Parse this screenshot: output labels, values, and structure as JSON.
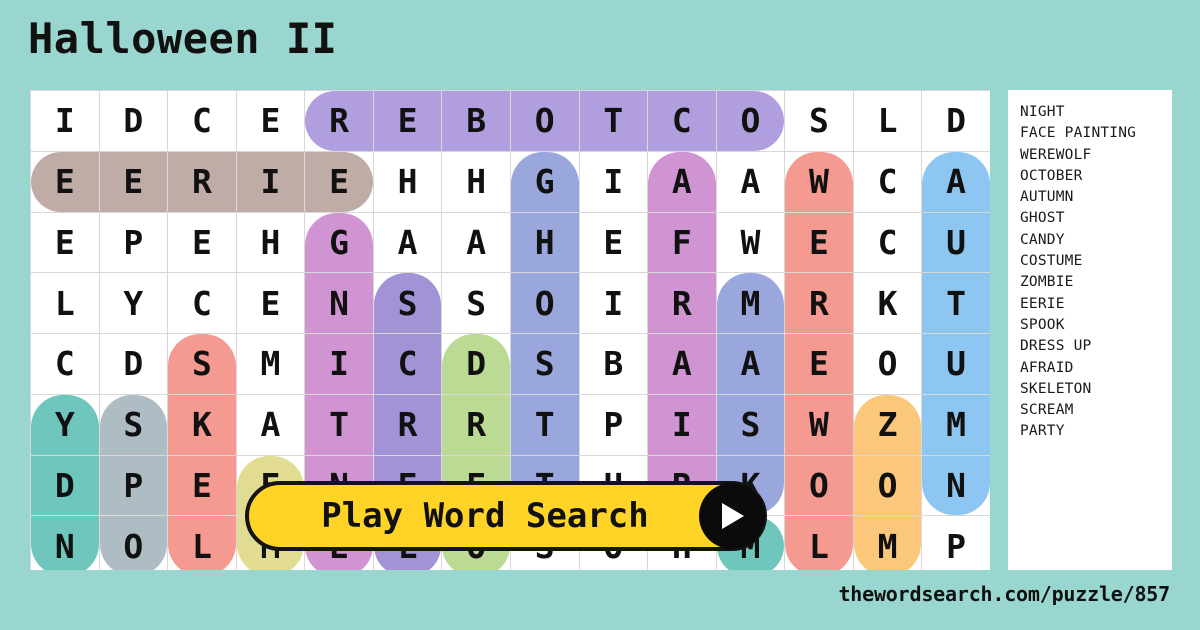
{
  "title": "Halloween II",
  "theme": {
    "background": "#99d6d0",
    "panel": "#ffffff",
    "text": "#111111",
    "button_fill": "#FFD426",
    "button_border": "#141414"
  },
  "grid": {
    "rows": 8,
    "cols": 14,
    "letters": [
      [
        "I",
        "D",
        "C",
        "E",
        "R",
        "E",
        "B",
        "O",
        "T",
        "C",
        "O",
        "S",
        "L",
        "D"
      ],
      [
        "E",
        "E",
        "R",
        "I",
        "E",
        "H",
        "H",
        "G",
        "I",
        "A",
        "A",
        "W",
        "C",
        "A"
      ],
      [
        "E",
        "P",
        "E",
        "H",
        "G",
        "A",
        "A",
        "H",
        "E",
        "F",
        "W",
        "E",
        "C",
        "U"
      ],
      [
        "L",
        "Y",
        "C",
        "E",
        "N",
        "S",
        "S",
        "O",
        "I",
        "R",
        "M",
        "R",
        "K",
        "T"
      ],
      [
        "C",
        "D",
        "S",
        "M",
        "I",
        "C",
        "D",
        "S",
        "B",
        "A",
        "A",
        "E",
        "O",
        "U"
      ],
      [
        "Y",
        "S",
        "K",
        "A",
        "T",
        "R",
        "R",
        "T",
        "P",
        "I",
        "S",
        "W",
        "Z",
        "M"
      ],
      [
        "D",
        "P",
        "E",
        "E",
        "N",
        "E",
        "E",
        "T",
        "H",
        "R",
        "K",
        "O",
        "O",
        "N"
      ],
      [
        "N",
        "O",
        "L",
        "M",
        "E",
        "L",
        "O",
        "S",
        "O",
        "H",
        "M",
        "L",
        "M",
        "P"
      ]
    ],
    "highlights": [
      {
        "word": "OCTOBER",
        "color": "#b09ede",
        "orientation": "horizontal",
        "row": 0,
        "col_start": 4,
        "col_end": 10
      },
      {
        "word": "EERIE",
        "color": "#bfaca6",
        "orientation": "horizontal",
        "row": 1,
        "col_start": 0,
        "col_end": 4
      },
      {
        "word": "GHOST",
        "color": "#9aa7dd",
        "orientation": "vertical",
        "col": 7,
        "row_start": 1,
        "row_end": 5
      },
      {
        "word": "AFRAID",
        "color": "#d194d3",
        "orientation": "vertical",
        "col": 9,
        "row_start": 1,
        "row_end": 6
      },
      {
        "word": "WEREWOLF",
        "color": "#f59a90",
        "orientation": "vertical",
        "col": 11,
        "row_start": 1,
        "row_end": 7
      },
      {
        "word": "AUTUMN",
        "color": "#8ec6f2",
        "orientation": "vertical",
        "col": 13,
        "row_start": 1,
        "row_end": 6
      },
      {
        "word": "GNIT",
        "color": "#d194d3",
        "orientation": "vertical",
        "col": 4,
        "row_start": 2,
        "row_end": 6
      },
      {
        "word": "SCREAM",
        "color": "#a193d6",
        "orientation": "vertical",
        "col": 5,
        "row_start": 3,
        "row_end": 7
      },
      {
        "word": "MAERCS",
        "color": "#9aa7dd",
        "orientation": "vertical",
        "col": 10,
        "row_start": 3,
        "row_end": 6
      },
      {
        "word": "SPOOK",
        "color": "#f59a90",
        "orientation": "vertical",
        "col": 2,
        "row_start": 4,
        "row_end": 7
      },
      {
        "word": "DRESSUP",
        "color": "#bbdb95",
        "orientation": "vertical",
        "col": 6,
        "row_start": 4,
        "row_end": 7
      },
      {
        "word": "CANDY",
        "color": "#6ec6bd",
        "orientation": "vertical",
        "col": 0,
        "row_start": 5,
        "row_end": 7
      },
      {
        "word": "SPOOK2",
        "color": "#aebdc4",
        "orientation": "vertical",
        "col": 1,
        "row_start": 5,
        "row_end": 7
      },
      {
        "word": "PARTY",
        "color": "#9aa7dd",
        "orientation": "vertical",
        "col": 7,
        "row_start": 5,
        "row_end": 6
      },
      {
        "word": "ZOMBIE",
        "color": "#fbc87b",
        "orientation": "vertical",
        "col": 12,
        "row_start": 5,
        "row_end": 7
      },
      {
        "word": "FACE",
        "color": "#e2dc93",
        "orientation": "vertical",
        "col": 3,
        "row_start": 6,
        "row_end": 7
      },
      {
        "word": "PAINT",
        "color": "#d194d3",
        "orientation": "vertical",
        "col": 4,
        "row_start": 7,
        "row_end": 7
      },
      {
        "word": "PAINT2",
        "color": "#a193d6",
        "orientation": "vertical",
        "col": 5,
        "row_start": 7,
        "row_end": 7
      },
      {
        "word": "ING",
        "color": "#bbdb95",
        "orientation": "vertical",
        "col": 6,
        "row_start": 7,
        "row_end": 7
      },
      {
        "word": "HALLO",
        "color": "#6ec6bd",
        "orientation": "vertical",
        "col": 10,
        "row_start": 7,
        "row_end": 7
      }
    ]
  },
  "wordlist": {
    "words": [
      "NIGHT",
      "FACE PAINTING",
      "WEREWOLF",
      "OCTOBER",
      "AUTUMN",
      "GHOST",
      "CANDY",
      "COSTUME",
      "ZOMBIE",
      "EERIE",
      "SPOOK",
      "DRESS UP",
      "AFRAID",
      "SKELETON",
      "SCREAM",
      "PARTY"
    ]
  },
  "play_button": {
    "label": "Play Word Search",
    "icon": "play-triangle-icon"
  },
  "footer": {
    "url": "thewordsearch.com/puzzle/857"
  }
}
